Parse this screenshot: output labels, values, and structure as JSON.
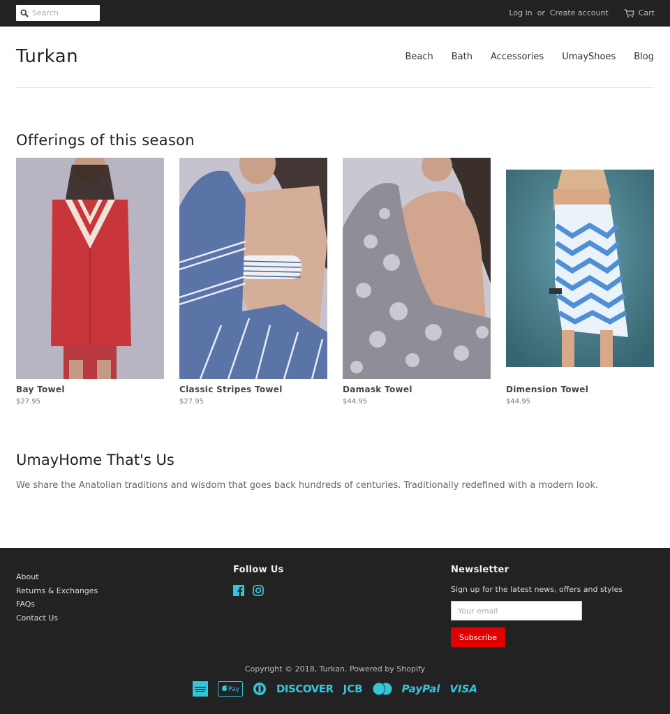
{
  "topbar": {
    "search_placeholder": "Search",
    "login": "Log in",
    "or": "or",
    "create_account": "Create account",
    "cart": "Cart"
  },
  "header": {
    "logo": "Turkan",
    "nav": [
      {
        "label": "Beach"
      },
      {
        "label": "Bath"
      },
      {
        "label": "Accessories"
      },
      {
        "label": "UmayShoes"
      },
      {
        "label": "Blog"
      }
    ]
  },
  "featured": {
    "title": "Offerings of this season",
    "products": [
      {
        "name": "Bay Towel",
        "price": "$27.95",
        "colors": {
          "bg": "#b8b4c2",
          "towel": "#c8363c",
          "stripe": "#efe3d8"
        }
      },
      {
        "name": "Classic Stripes Towel",
        "price": "$27.95",
        "colors": {
          "bg": "#c6c3cf",
          "towel": "#5a74a8",
          "stripe": "#e8ecf4"
        }
      },
      {
        "name": "Damask Towel",
        "price": "$44.95",
        "colors": {
          "bg": "#c9c8d2",
          "towel": "#8f8e98",
          "stripe": "#dedde3"
        }
      },
      {
        "name": "Dimension Towel",
        "price": "$44.95",
        "colors": {
          "bg": "#4f8a98",
          "towel": "#4f8fd6",
          "stripe": "#eaf2fa"
        }
      }
    ]
  },
  "about": {
    "title": "UmayHome That's Us",
    "text": "We share the Anatolian traditions and wisdom that goes back hundreds of centuries. Traditionally redefined with a modern look."
  },
  "footer": {
    "links": [
      {
        "label": "About"
      },
      {
        "label": "Returns & Exchanges"
      },
      {
        "label": "FAQs"
      },
      {
        "label": "Contact Us"
      }
    ],
    "follow_title": "Follow Us",
    "social": [
      "facebook-icon",
      "instagram-icon"
    ],
    "newsletter_title": "Newsletter",
    "newsletter_text": "Sign up for the latest news, offers and styles",
    "email_placeholder": "Your email",
    "subscribe": "Subscribe",
    "copyright_prefix": "Copyright © 2018,",
    "copyright_brand": "Turkan",
    "powered_by": "Powered by Shopify",
    "payments": [
      "American Express",
      "Apple Pay",
      "Diners Club",
      "DISCOVER",
      "JCB",
      "Master",
      "PayPal",
      "VISA"
    ],
    "accent_color": "#35c5d8",
    "button_color": "#e00000"
  }
}
